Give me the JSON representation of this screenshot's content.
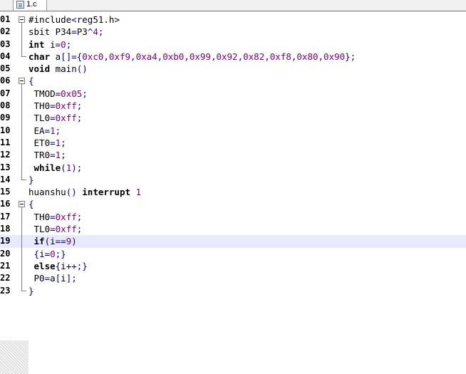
{
  "tab": {
    "label": "1.c",
    "icon": "c-file-icon"
  },
  "colors": {
    "keyword": "#000000",
    "number": "#800080",
    "operator": "#0000aa",
    "current_line": "#e8e8ff"
  },
  "current_line": 19,
  "lines": [
    {
      "n": "01",
      "fold": "open",
      "tokens": [
        [
          "p",
          "#include"
        ],
        [
          "o",
          "<"
        ],
        [
          "p",
          "reg51.h"
        ],
        [
          "o",
          ">"
        ]
      ]
    },
    {
      "n": "02",
      "fold": "bar",
      "tokens": [
        [
          "p",
          "sbit P34"
        ],
        [
          "o",
          "="
        ],
        [
          "p",
          "P3"
        ],
        [
          "o",
          "^"
        ],
        [
          "n",
          "4"
        ],
        [
          "o",
          ";"
        ]
      ]
    },
    {
      "n": "03",
      "fold": "bar",
      "tokens": [
        [
          "k",
          "int"
        ],
        [
          "p",
          " i"
        ],
        [
          "o",
          "="
        ],
        [
          "n",
          "0"
        ],
        [
          "o",
          ";"
        ]
      ]
    },
    {
      "n": "04",
      "fold": "end",
      "tokens": [
        [
          "k",
          "char"
        ],
        [
          "p",
          " a"
        ],
        [
          "o",
          "[]={"
        ],
        [
          "n",
          "0xc0"
        ],
        [
          "o",
          ","
        ],
        [
          "n",
          "0xf9"
        ],
        [
          "o",
          ","
        ],
        [
          "n",
          "0xa4"
        ],
        [
          "o",
          ","
        ],
        [
          "n",
          "0xb0"
        ],
        [
          "o",
          ","
        ],
        [
          "n",
          "0x99"
        ],
        [
          "o",
          ","
        ],
        [
          "n",
          "0x92"
        ],
        [
          "o",
          ","
        ],
        [
          "n",
          "0x82"
        ],
        [
          "o",
          ","
        ],
        [
          "n",
          "0xf8"
        ],
        [
          "o",
          ","
        ],
        [
          "n",
          "0x80"
        ],
        [
          "o",
          ","
        ],
        [
          "n",
          "0x90"
        ],
        [
          "o",
          "};"
        ]
      ]
    },
    {
      "n": "05",
      "fold": "none",
      "tokens": [
        [
          "k",
          "void"
        ],
        [
          "p",
          " main"
        ],
        [
          "o",
          "()"
        ]
      ]
    },
    {
      "n": "06",
      "fold": "open",
      "tokens": [
        [
          "o",
          "{"
        ]
      ]
    },
    {
      "n": "07",
      "fold": "bar",
      "tokens": [
        [
          "p",
          " TMOD"
        ],
        [
          "o",
          "="
        ],
        [
          "n",
          "0x05"
        ],
        [
          "o",
          ";"
        ]
      ]
    },
    {
      "n": "08",
      "fold": "bar",
      "tokens": [
        [
          "p",
          " TH0"
        ],
        [
          "o",
          "="
        ],
        [
          "n",
          "0xff"
        ],
        [
          "o",
          ";"
        ]
      ]
    },
    {
      "n": "09",
      "fold": "bar",
      "tokens": [
        [
          "p",
          " TL0"
        ],
        [
          "o",
          "="
        ],
        [
          "n",
          "0xff"
        ],
        [
          "o",
          ";"
        ]
      ]
    },
    {
      "n": "10",
      "fold": "bar",
      "tokens": [
        [
          "p",
          " EA"
        ],
        [
          "o",
          "="
        ],
        [
          "n",
          "1"
        ],
        [
          "o",
          ";"
        ]
      ]
    },
    {
      "n": "11",
      "fold": "bar",
      "tokens": [
        [
          "p",
          " ET0"
        ],
        [
          "o",
          "="
        ],
        [
          "n",
          "1"
        ],
        [
          "o",
          ";"
        ]
      ]
    },
    {
      "n": "12",
      "fold": "bar",
      "tokens": [
        [
          "p",
          " TR0"
        ],
        [
          "o",
          "="
        ],
        [
          "n",
          "1"
        ],
        [
          "o",
          ";"
        ]
      ]
    },
    {
      "n": "13",
      "fold": "bar",
      "tokens": [
        [
          "k",
          " while"
        ],
        [
          "o",
          "("
        ],
        [
          "n",
          "1"
        ],
        [
          "o",
          ");"
        ]
      ]
    },
    {
      "n": "14",
      "fold": "end",
      "tokens": [
        [
          "o",
          "}"
        ]
      ]
    },
    {
      "n": "15",
      "fold": "none",
      "tokens": [
        [
          "p",
          "huanshu"
        ],
        [
          "o",
          "()"
        ],
        [
          "p",
          " "
        ],
        [
          "k",
          "interrupt"
        ],
        [
          "p",
          " "
        ],
        [
          "n",
          "1"
        ]
      ]
    },
    {
      "n": "16",
      "fold": "open",
      "tokens": [
        [
          "o",
          "{"
        ]
      ]
    },
    {
      "n": "17",
      "fold": "bar",
      "tokens": [
        [
          "p",
          " TH0"
        ],
        [
          "o",
          "="
        ],
        [
          "n",
          "0xff"
        ],
        [
          "o",
          ";"
        ]
      ]
    },
    {
      "n": "18",
      "fold": "bar",
      "tokens": [
        [
          "p",
          " TL0"
        ],
        [
          "o",
          "="
        ],
        [
          "n",
          "0xff"
        ],
        [
          "o",
          ";"
        ]
      ]
    },
    {
      "n": "19",
      "fold": "bar",
      "tokens": [
        [
          "k",
          " if"
        ],
        [
          "o",
          "("
        ],
        [
          "p",
          "i"
        ],
        [
          "o",
          "=="
        ],
        [
          "n",
          "9"
        ],
        [
          "o",
          ")"
        ]
      ]
    },
    {
      "n": "20",
      "fold": "bar",
      "tokens": [
        [
          "o",
          " {"
        ],
        [
          "p",
          "i"
        ],
        [
          "o",
          "="
        ],
        [
          "n",
          "0"
        ],
        [
          "o",
          ";}"
        ]
      ]
    },
    {
      "n": "21",
      "fold": "bar",
      "tokens": [
        [
          "k",
          " else"
        ],
        [
          "o",
          "{"
        ],
        [
          "p",
          "i"
        ],
        [
          "o",
          "++;}"
        ]
      ]
    },
    {
      "n": "22",
      "fold": "bar",
      "tokens": [
        [
          "p",
          " P0"
        ],
        [
          "o",
          "="
        ],
        [
          "p",
          "a"
        ],
        [
          "o",
          "["
        ],
        [
          "p",
          "i"
        ],
        [
          "o",
          "];"
        ]
      ]
    },
    {
      "n": "23",
      "fold": "end",
      "tokens": [
        [
          "o",
          "}"
        ]
      ]
    }
  ]
}
